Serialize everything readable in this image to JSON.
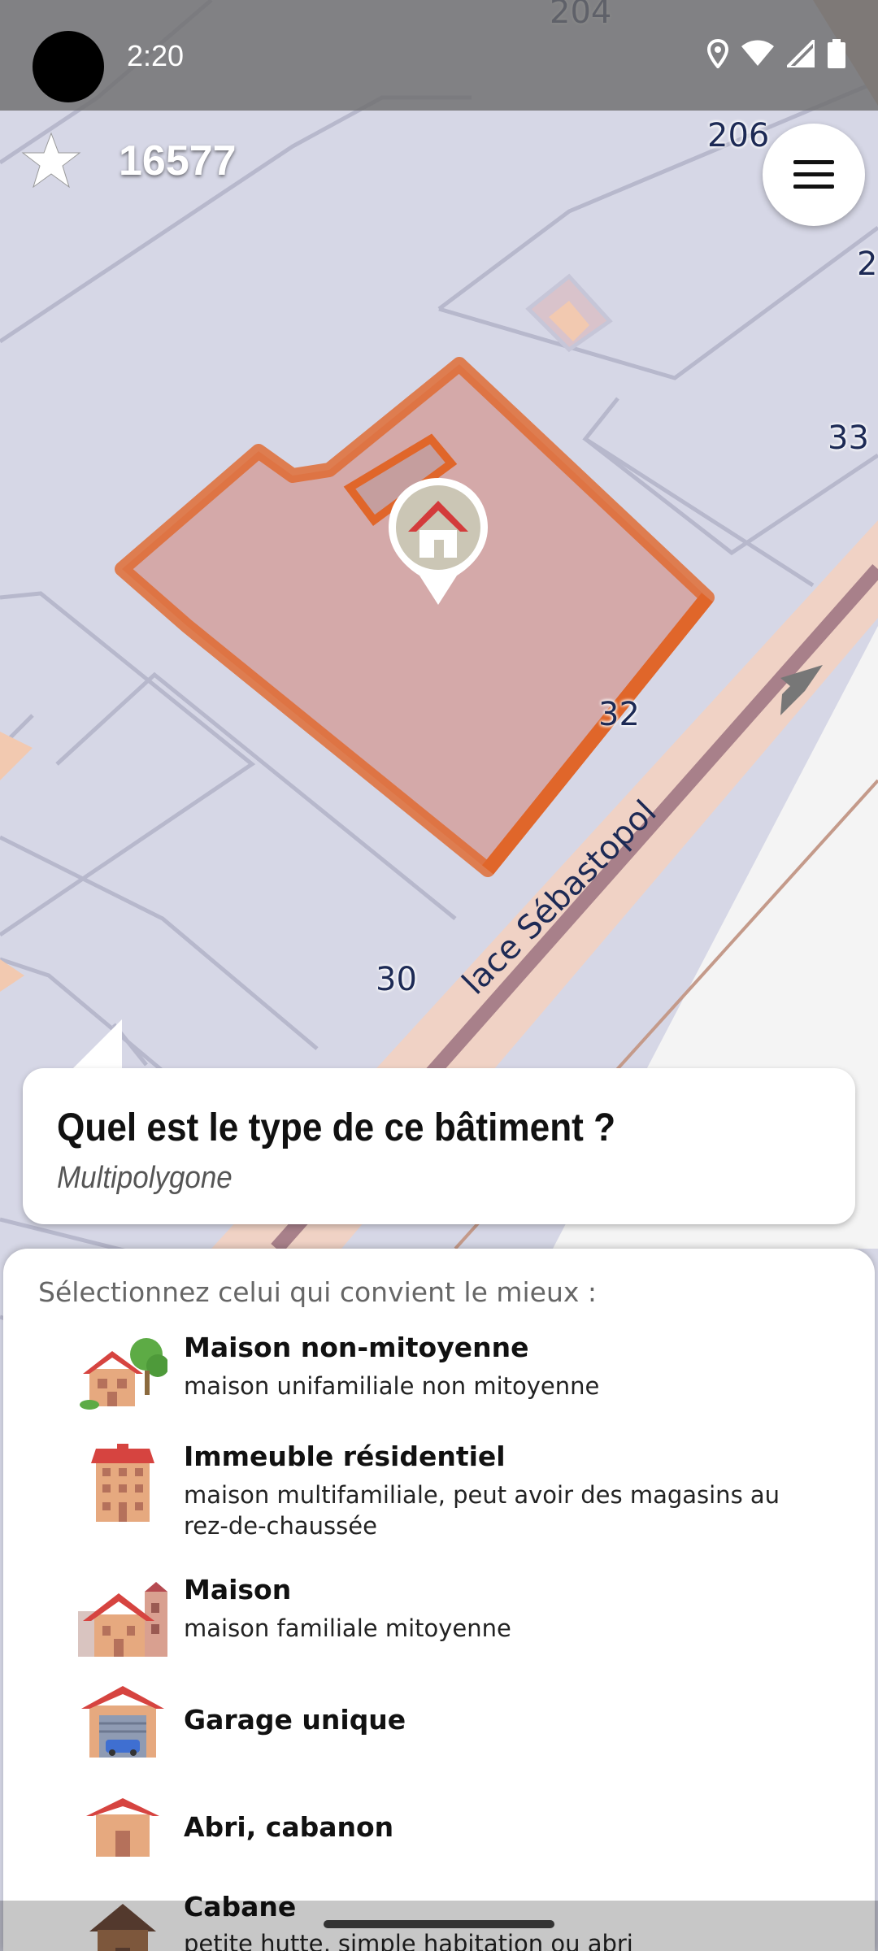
{
  "status_bar": {
    "time": "2:20",
    "icons": [
      "location-icon",
      "wifi-icon",
      "cell-signal-icon",
      "battery-icon"
    ]
  },
  "toolbar": {
    "points": "16577",
    "star_icon": "star-icon",
    "menu_icon": "hamburger-menu-icon"
  },
  "map": {
    "labels": {
      "n204": "204",
      "n206": "206",
      "n2": "2",
      "n33": "33",
      "n32": "32",
      "n30": "30"
    },
    "street_name": "lace Sébastopol",
    "colors": {
      "background": "#d6d7e6",
      "road": "#f0d2c5",
      "highlight": "#e0662a"
    }
  },
  "question": {
    "title": "Quel est le type de ce bâtiment ?",
    "subtitle": "Multipolygone"
  },
  "answers": {
    "prompt": "Sélectionnez celui qui convient le mieux :",
    "options": [
      {
        "label": "Maison non-mitoyenne",
        "description": "maison unifamiliale non mitoyenne",
        "icon": "detached-house-icon"
      },
      {
        "label": "Immeuble résidentiel",
        "description": "maison multifamiliale, peut avoir des magasins au rez-de-chaussée",
        "icon": "apartment-building-icon"
      },
      {
        "label": "Maison",
        "description": "maison familiale mitoyenne",
        "icon": "terraced-house-icon"
      },
      {
        "label": "Garage unique",
        "description": "",
        "icon": "garage-icon"
      },
      {
        "label": "Abri, cabanon",
        "description": "",
        "icon": "shed-icon"
      },
      {
        "label": "Cabane",
        "description": "petite hutte, simple habitation ou abri",
        "icon": "hut-icon"
      }
    ]
  }
}
